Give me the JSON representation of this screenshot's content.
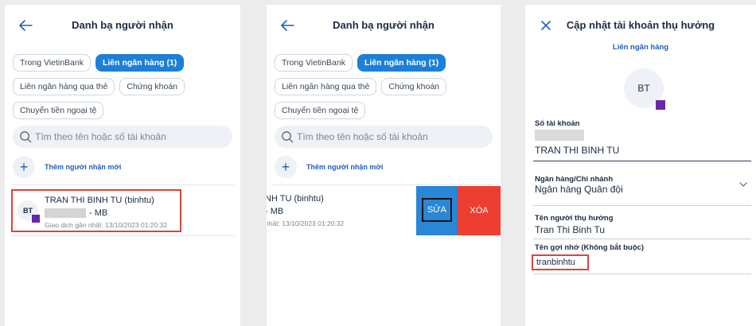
{
  "list_screen": {
    "title": "Danh bạ người nhận",
    "tabs": [
      {
        "label": "Trong VietinBank",
        "active": false
      },
      {
        "label": "Liên ngân hàng (1)",
        "active": true
      },
      {
        "label": "Liên ngân hàng qua thẻ",
        "active": false
      },
      {
        "label": "Chứng khoán",
        "active": false
      },
      {
        "label": "Chuyển tiền ngoại tệ",
        "active": false
      }
    ],
    "search_placeholder": "Tìm theo tên hoặc số tài khoản",
    "add_label": "Thêm người nhận mới",
    "contact": {
      "initials": "BT",
      "name": "TRAN THI BINH TU (binhtu)",
      "bank": "- MB",
      "last_tx": "Giao dịch gần nhất: 13/10/2023 01:20:32"
    }
  },
  "swipe_screen": {
    "title": "Danh bạ người nhận",
    "name": "NH TU (binhtu)",
    "bank": "- MB",
    "last_tx": "nhất: 13/10/2023 01:20:32",
    "edit_label": "SỬA",
    "delete_label": "XÓA"
  },
  "edit_screen": {
    "title": "Cập nhật tài khoản thụ hưởng",
    "subtitle": "Liên ngân hàng",
    "initials": "BT",
    "account_label": "Số tài khoản",
    "account_holder": "TRAN THI BINH TU",
    "bank_label": "Ngân hàng/Chi nhánh",
    "bank_value": "Ngân hàng Quân đội",
    "beneficiary_label": "Tên người thụ hưởng",
    "beneficiary_value": "Tran Thi Binh Tu",
    "nickname_label": "Tên gợi nhớ (Không bắt buộc)",
    "nickname_value": "tranbinhtu"
  },
  "colors": {
    "primary": "#1d7fd6",
    "edit_button": "#2a86d6",
    "delete_button": "#ee3e32",
    "highlight_border": "#d9453b",
    "badge": "#6a27a8"
  }
}
